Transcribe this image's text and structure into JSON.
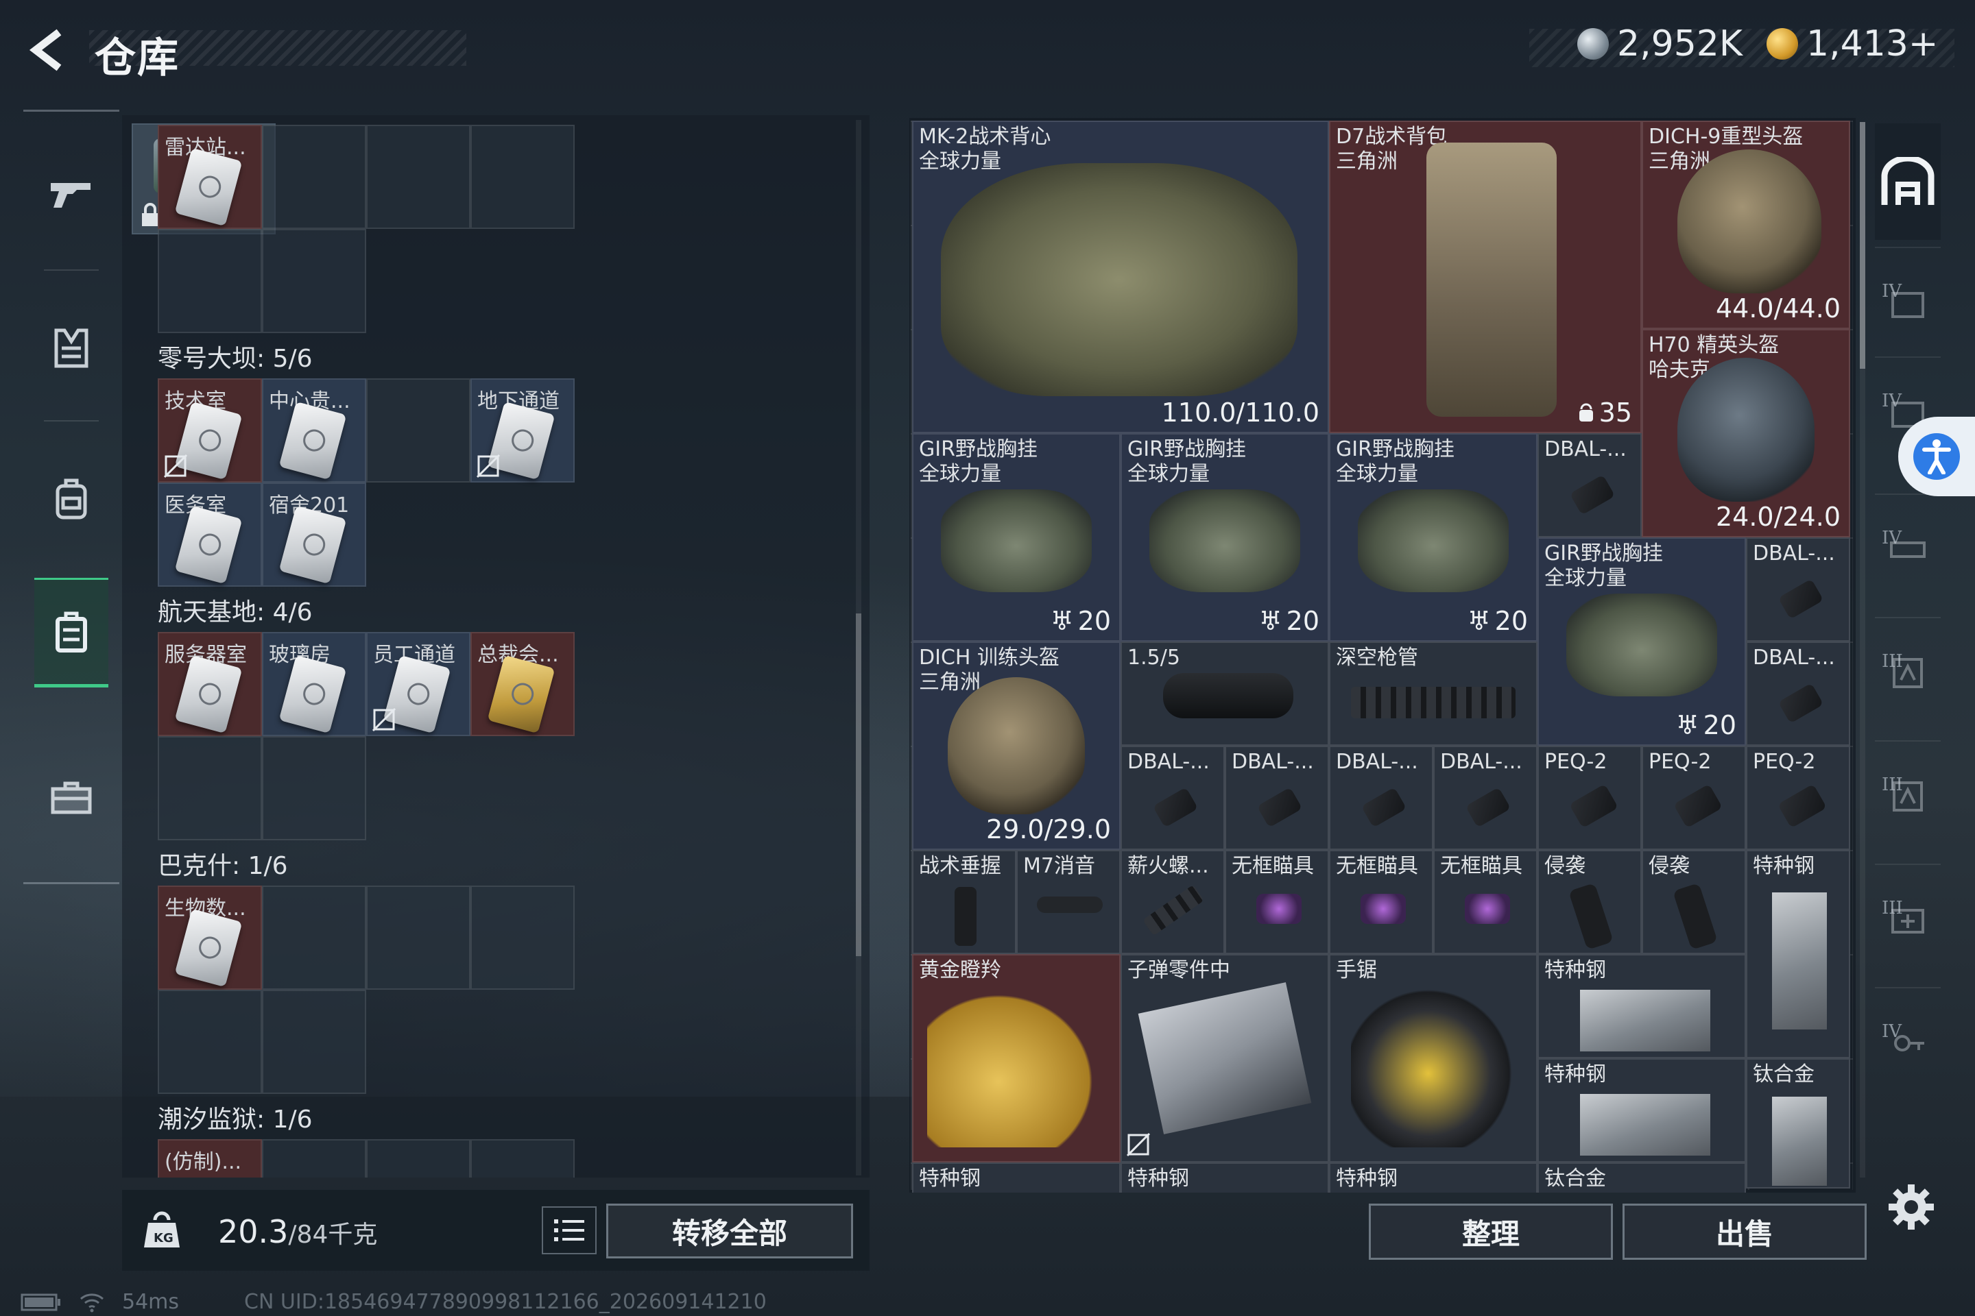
{
  "header": {
    "title": "仓库",
    "currency_silver": "2,952K",
    "currency_gold": "1,413+"
  },
  "left_nav": {
    "items": [
      "gun-icon",
      "vest-icon",
      "backpack-icon",
      "storage-icon",
      "toolbox-icon"
    ],
    "active_index": 3
  },
  "left_panel": {
    "top_cell_label": "雷达站...",
    "sections": [
      {
        "title": "零号大坝: 5/6",
        "cells": [
          "技术室",
          "中心贵...",
          "地下通道",
          "医务室",
          "宿舍201"
        ]
      },
      {
        "title": "航天基地: 4/6",
        "cells": [
          "服务器室",
          "玻璃房",
          "员工通道",
          "总裁会..."
        ]
      },
      {
        "title": "巴克什: 1/6",
        "cells": [
          "生物数..."
        ]
      },
      {
        "title": "潮汐监狱: 1/6",
        "cells": [
          "(仿制)..."
        ]
      }
    ],
    "weight_current": "20.3",
    "weight_max": "/84千克",
    "transfer_label": "转移全部"
  },
  "inventory": {
    "items": [
      {
        "name": "MK-2战术背心",
        "sub": "全球力量",
        "value": "110.0/110.0"
      },
      {
        "name": "D7战术背包",
        "sub": "三角洲",
        "value": "35"
      },
      {
        "name": "DICH-9重型头盔",
        "sub": "三角洲",
        "value": "44.0/44.0"
      },
      {
        "name": "H70 精英头盔",
        "sub": "哈夫克",
        "value": "24.0/24.0"
      },
      {
        "name": "GIR野战胸挂",
        "sub": "全球力量",
        "value": "20"
      },
      {
        "name": "GIR野战胸挂",
        "sub": "全球力量",
        "value": "20"
      },
      {
        "name": "GIR野战胸挂",
        "sub": "全球力量",
        "value": "20"
      },
      {
        "name": "GIR野战胸挂",
        "sub": "全球力量",
        "value": "20"
      },
      {
        "name": "DICH 训练头盔",
        "sub": "三角洲",
        "value": "29.0/29.0"
      },
      {
        "name": "1.5/5"
      },
      {
        "name": "深空枪管"
      },
      {
        "name": "DBAL-..."
      },
      {
        "name": "PEQ-2"
      },
      {
        "name": "战术垂握"
      },
      {
        "name": "M7消音"
      },
      {
        "name": "薪火螺..."
      },
      {
        "name": "无框瞄具"
      },
      {
        "name": "侵袭"
      },
      {
        "name": "特种钢"
      },
      {
        "name": "钛合金"
      },
      {
        "name": "黄金瞪羚"
      },
      {
        "name": "子弹零件中"
      },
      {
        "name": "手锯"
      }
    ],
    "sort_label": "整理",
    "sell_label": "出售"
  },
  "right_bar": {
    "tiers": [
      "IV",
      "IV",
      "IV",
      "III",
      "III",
      "III",
      "IV"
    ]
  },
  "status": {
    "ping": "54ms",
    "uid": "CN UID:18546947789099811216​6_202609141210"
  }
}
